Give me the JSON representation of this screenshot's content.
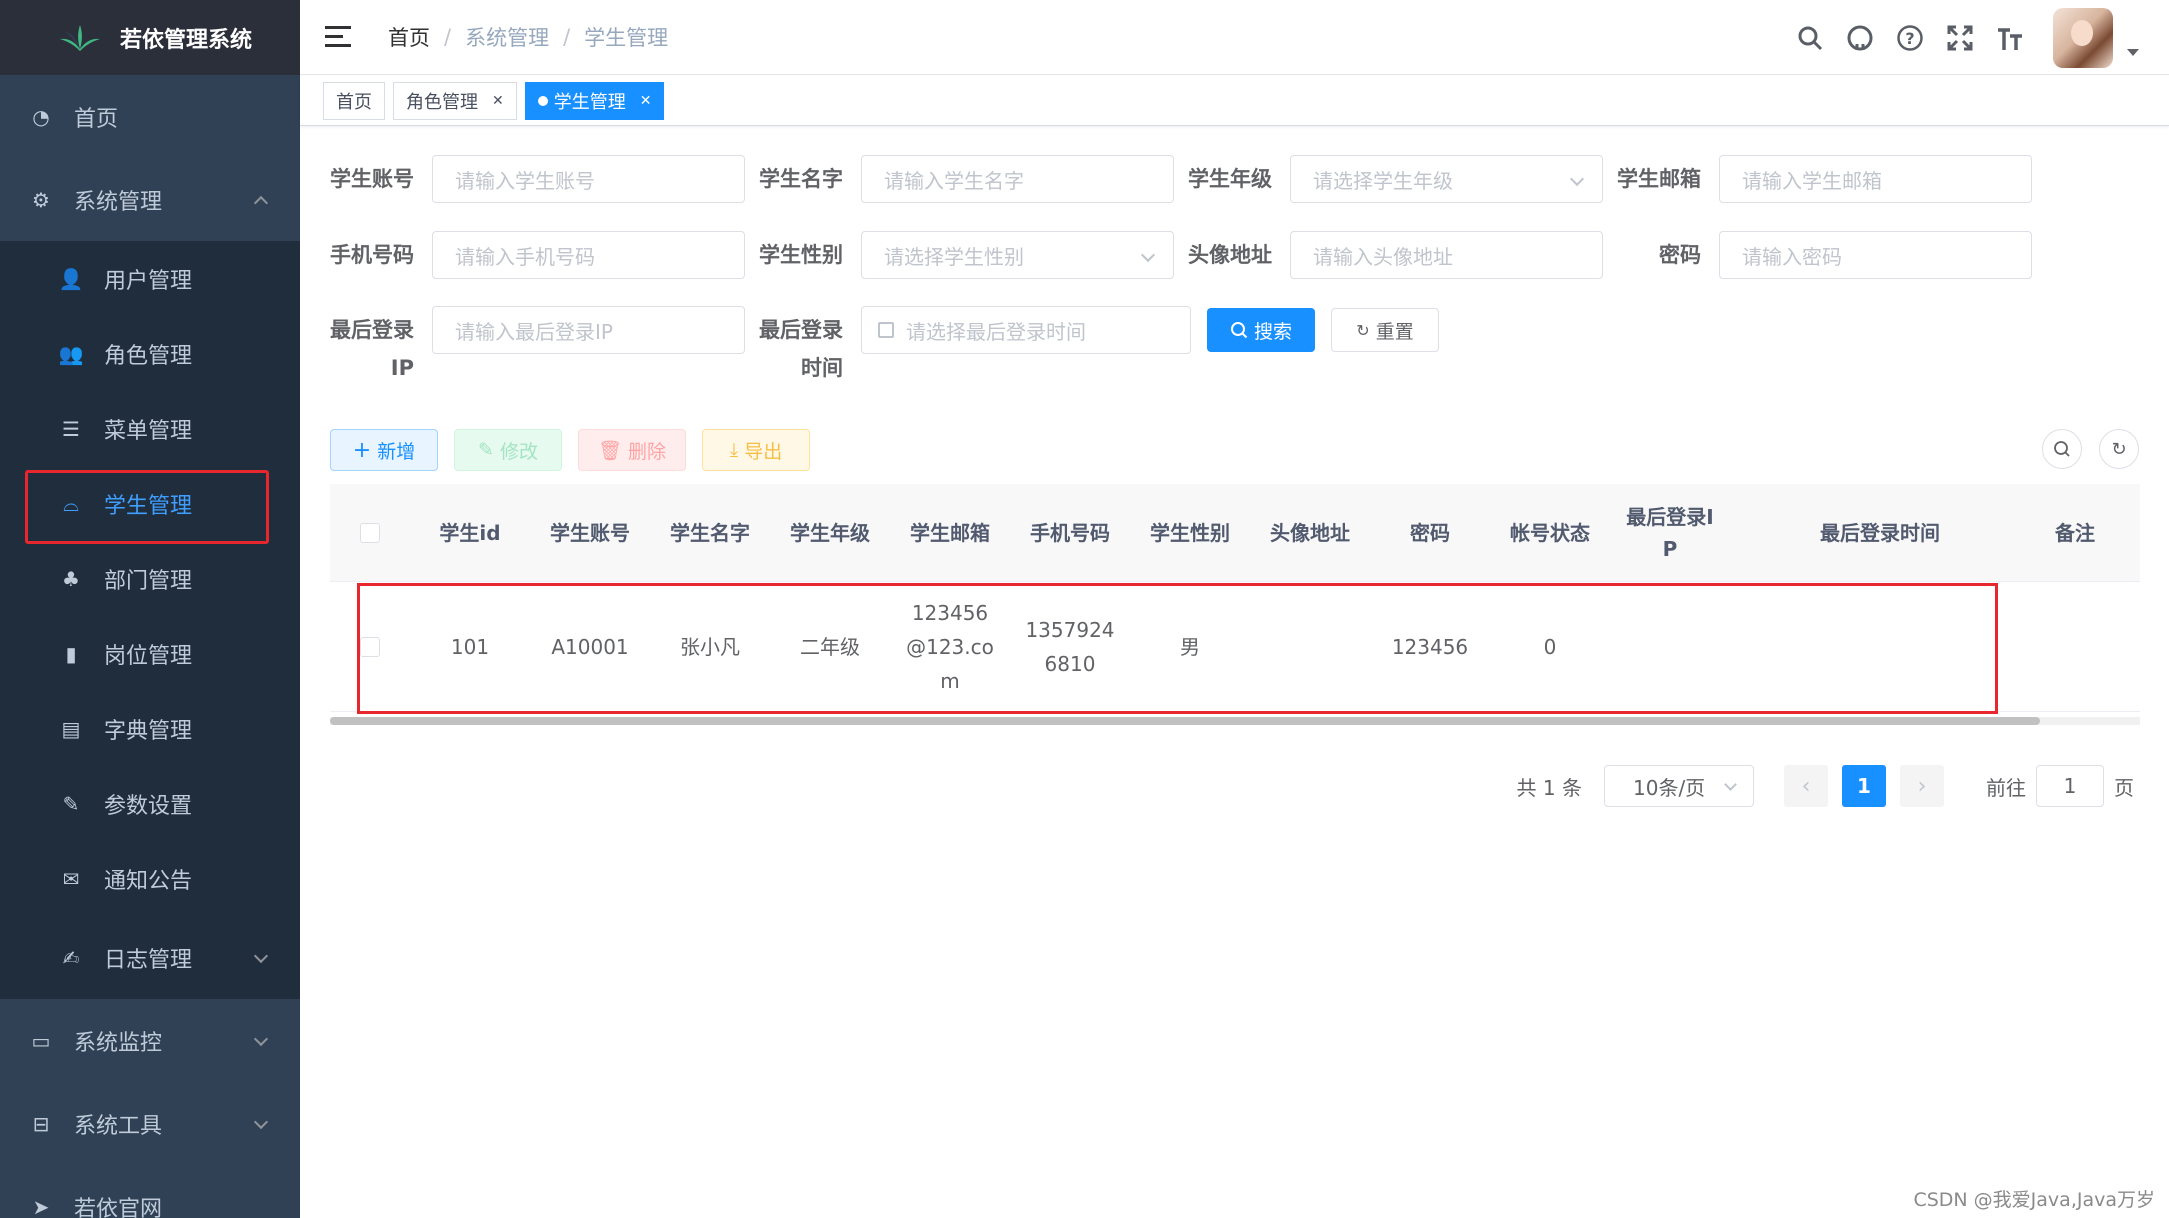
{
  "app": {
    "title": "若依管理系统"
  },
  "sidebar": {
    "items": [
      {
        "label": "首页",
        "icon": "dashboard-icon"
      },
      {
        "label": "系统管理",
        "icon": "gear-icon",
        "expanded": true
      }
    ],
    "submenu": [
      {
        "label": "用户管理",
        "icon": "user-icon"
      },
      {
        "label": "角色管理",
        "icon": "peoples-icon"
      },
      {
        "label": "菜单管理",
        "icon": "tree-table-icon"
      },
      {
        "label": "学生管理",
        "icon": "education-icon",
        "active": true
      },
      {
        "label": "部门管理",
        "icon": "tree-icon"
      },
      {
        "label": "岗位管理",
        "icon": "post-icon"
      },
      {
        "label": "字典管理",
        "icon": "dict-icon"
      },
      {
        "label": "参数设置",
        "icon": "edit-icon"
      },
      {
        "label": "通知公告",
        "icon": "message-icon"
      },
      {
        "label": "日志管理",
        "icon": "log-icon"
      }
    ],
    "bottom": [
      {
        "label": "系统监控",
        "icon": "monitor-icon"
      },
      {
        "label": "系统工具",
        "icon": "tool-icon"
      },
      {
        "label": "若依官网",
        "icon": "guide-icon"
      }
    ]
  },
  "navbar": {
    "breadcrumb": [
      "首页",
      "系统管理",
      "学生管理"
    ],
    "tools": [
      "search-icon",
      "github-icon",
      "question-icon",
      "fullscreen-icon",
      "font-size-icon"
    ]
  },
  "tags": [
    {
      "label": "首页"
    },
    {
      "label": "角色管理",
      "closable": true
    },
    {
      "label": "学生管理",
      "closable": true,
      "active": true
    }
  ],
  "form": {
    "row1": [
      {
        "label": "学生账号",
        "placeholder": "请输入学生账号"
      },
      {
        "label": "学生名字",
        "placeholder": "请输入学生名字"
      },
      {
        "label": "学生年级",
        "placeholder": "请选择学生年级",
        "select": true
      },
      {
        "label": "学生邮箱",
        "placeholder": "请输入学生邮箱"
      }
    ],
    "row2": [
      {
        "label": "手机号码",
        "placeholder": "请输入手机号码"
      },
      {
        "label": "学生性别",
        "placeholder": "请选择学生性别",
        "select": true
      },
      {
        "label": "头像地址",
        "placeholder": "请输入头像地址"
      },
      {
        "label": "密码",
        "placeholder": "请输入密码"
      }
    ],
    "row3": {
      "ip_label_1": "最后登录",
      "ip_label_2": "IP",
      "ip_placeholder": "请输入最后登录IP",
      "time_label_1": "最后登录",
      "time_label_2": "时间",
      "time_placeholder": "请选择最后登录时间",
      "search_label": "搜索",
      "reset_label": "重置"
    }
  },
  "toolbar": {
    "add": "新增",
    "edit": "修改",
    "delete": "删除",
    "export": "导出"
  },
  "table": {
    "headers": [
      "学生id",
      "学生账号",
      "学生名字",
      "学生年级",
      "学生邮箱",
      "手机号码",
      "学生性别",
      "头像地址",
      "密码",
      "帐号状态",
      "最后登录I",
      "P",
      "最后登录时间",
      "备注"
    ],
    "rows": [
      {
        "id": "101",
        "account": "A10001",
        "name": "张小凡",
        "grade": "二年级",
        "email_1": "123456",
        "email_2": "@123.co",
        "email_3": "m",
        "phone_1": "1357924",
        "phone_2": "6810",
        "gender": "男",
        "avatar": "",
        "password": "123456",
        "status": "0",
        "login_ip": "",
        "login_time": "",
        "remark": ""
      }
    ]
  },
  "pagination": {
    "total": "共 1 条",
    "page_size": "10条/页",
    "prev": "‹",
    "current": "1",
    "next": "›",
    "goto_label": "前往",
    "goto_value": "1",
    "page_suffix": "页"
  },
  "watermark": "CSDN @我爱Java,Java万岁",
  "colors": {
    "accent": "#1890ff",
    "sidebar": "#304156",
    "highlight": "#e8262d"
  }
}
